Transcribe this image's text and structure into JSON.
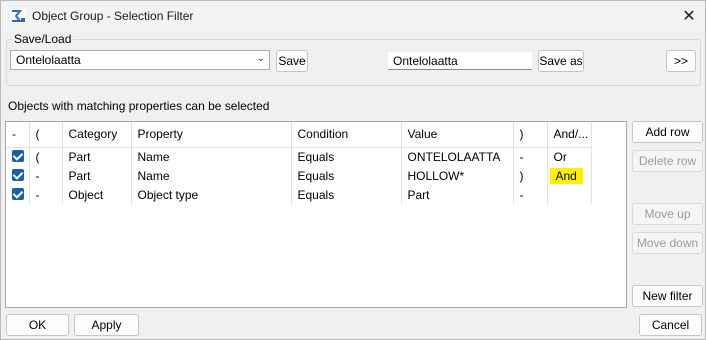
{
  "window": {
    "title": "Object Group - Selection Filter"
  },
  "save_load": {
    "group_label": "Save/Load",
    "combo_value": "Ontelolaatta",
    "save_label": "Save",
    "name_value": "Ontelolaatta",
    "save_as_label": "Save as",
    "expand_label": ">>"
  },
  "hint": "Objects with matching properties can be selected",
  "columns": [
    "-",
    "(",
    "Category",
    "Property",
    "Condition",
    "Value",
    ")",
    "And/..."
  ],
  "rows": [
    {
      "paren_open": "(",
      "category": "Part",
      "property": "Name",
      "condition": "Equals",
      "value": "ONTELOLAATTA",
      "paren_close": "-",
      "andor": "Or"
    },
    {
      "paren_open": "-",
      "category": "Part",
      "property": "Name",
      "condition": "Equals",
      "value": "HOLLOW*",
      "paren_close": ")",
      "andor": "And"
    },
    {
      "paren_open": "-",
      "category": "Object",
      "property": "Object type",
      "condition": "Equals",
      "value": "Part",
      "paren_close": "-",
      "andor": ""
    }
  ],
  "side_buttons": {
    "add_row": "Add row",
    "delete_row": "Delete row",
    "move_up": "Move up",
    "move_down": "Move down",
    "new_filter": "New filter"
  },
  "footer": {
    "ok": "OK",
    "apply": "Apply",
    "cancel": "Cancel"
  },
  "colors": {
    "check": "#1b5fa6",
    "highlight": "#fff200"
  }
}
